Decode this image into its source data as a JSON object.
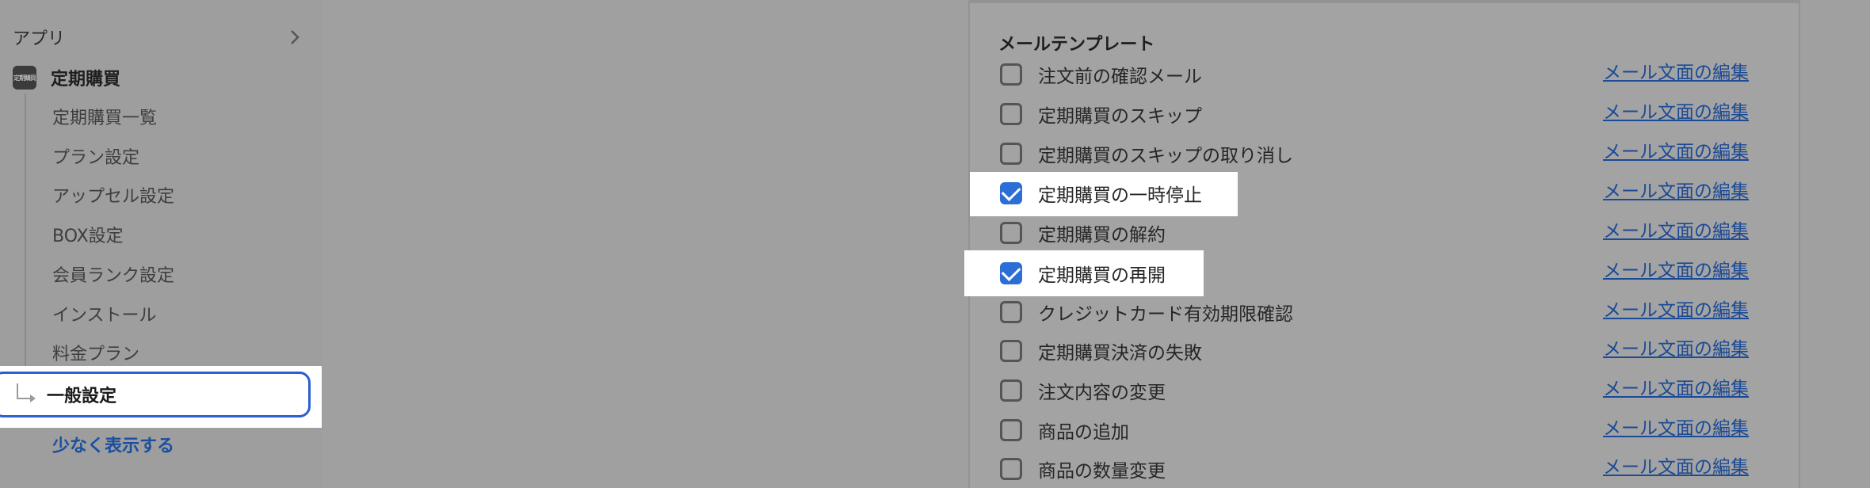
{
  "sidebar": {
    "section_label": "アプリ",
    "app": {
      "icon_text": "定期購買",
      "title": "定期購買"
    },
    "items": [
      {
        "label": "定期購買一覧"
      },
      {
        "label": "プラン設定"
      },
      {
        "label": "アップセル設定"
      },
      {
        "label": "BOX設定"
      },
      {
        "label": "会員ランク設定"
      },
      {
        "label": "インストール"
      },
      {
        "label": "料金プラン"
      }
    ],
    "active_item": "一般設定",
    "show_less": "少なく表示する"
  },
  "mail_templates": {
    "title": "メールテンプレート",
    "edit_link_label": "メール文面の編集",
    "rows": [
      {
        "label": "注文前の確認メール",
        "checked": false
      },
      {
        "label": "定期購買のスキップ",
        "checked": false
      },
      {
        "label": "定期購買のスキップの取り消し",
        "checked": false
      },
      {
        "label": "定期購買の一時停止",
        "checked": true
      },
      {
        "label": "定期購買の解約",
        "checked": false
      },
      {
        "label": "定期購買の再開",
        "checked": true
      },
      {
        "label": "クレジットカード有効期限確認",
        "checked": false
      },
      {
        "label": "定期購買決済の失敗",
        "checked": false
      },
      {
        "label": "注文内容の変更",
        "checked": false
      },
      {
        "label": "商品の追加",
        "checked": false
      },
      {
        "label": "商品の数量変更",
        "checked": false
      }
    ]
  }
}
